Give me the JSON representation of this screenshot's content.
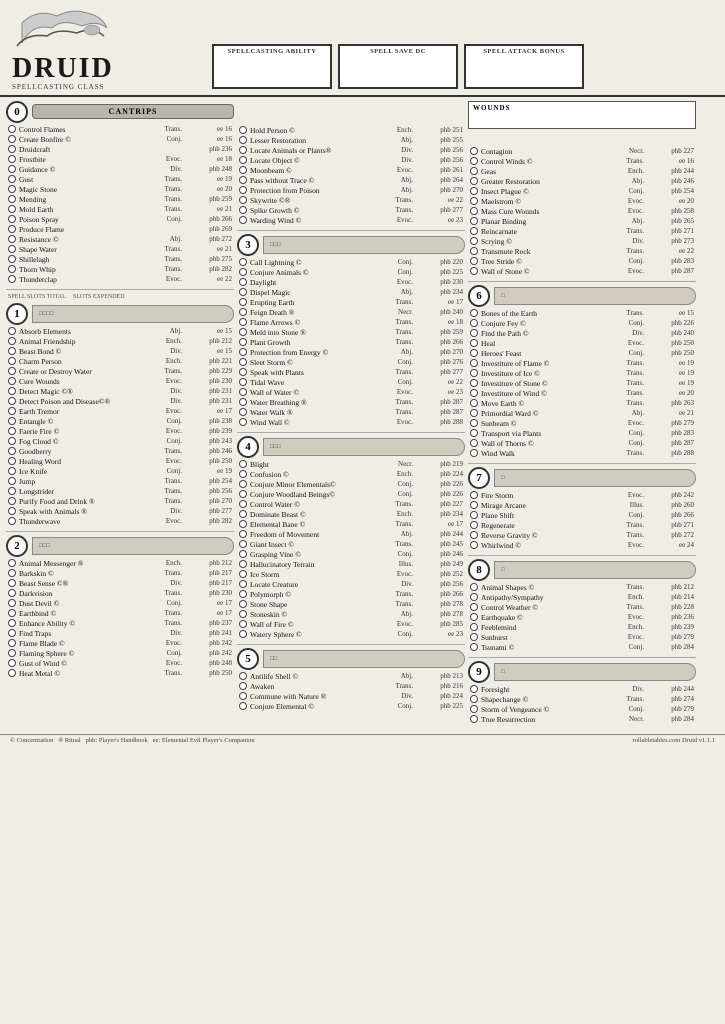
{
  "header": {
    "title": "Druid",
    "spellcasting_class": "Spellcasting Class",
    "spellcasting_ability": "Spellcasting Ability",
    "spell_save_dc": "Spell Save DC",
    "spell_attack_bonus": "Spell Attack Bonus"
  },
  "footer": {
    "concentration": "© Concentration",
    "ritual": "® Ritual",
    "phb": "phb: Player's Handbook",
    "ee": "ee: Elemental Evil Player's Companion",
    "url": "rollabletables.com Druid v1.1.1"
  },
  "cantrips": {
    "label": "Cantrips",
    "spells": [
      {
        "name": "Control Flames",
        "school": "Trans.",
        "source": "ee 16"
      },
      {
        "name": "Create Bonfire ©",
        "school": "Conj.",
        "source": "ee 16"
      },
      {
        "name": "Druidcraft",
        "school": "",
        "source": "phb 236"
      },
      {
        "name": "Frostbite",
        "school": "Evoc.",
        "source": "ee 18"
      },
      {
        "name": "Guidance ©",
        "school": "Div.",
        "source": "phb 248"
      },
      {
        "name": "Gust",
        "school": "Trans.",
        "source": "ee 19"
      },
      {
        "name": "Magic Stone",
        "school": "Trans.",
        "source": "ee 20"
      },
      {
        "name": "Mending",
        "school": "Trans.",
        "source": "phb 259"
      },
      {
        "name": "Mold Earth",
        "school": "Trans.",
        "source": "ee 21"
      },
      {
        "name": "Poison Spray",
        "school": "Conj.",
        "source": "phb 266"
      },
      {
        "name": "Produce Flame",
        "school": "",
        "source": "phb 269"
      },
      {
        "name": "Resistance ©",
        "school": "Abj.",
        "source": "phb 272"
      },
      {
        "name": "Shape Water",
        "school": "Trans.",
        "source": "ee 21"
      },
      {
        "name": "Shillelagh",
        "school": "Trans.",
        "source": "phb 275"
      },
      {
        "name": "Thorn Whip",
        "school": "Trans.",
        "source": "phb 282"
      },
      {
        "name": "Thunderclap",
        "school": "Evoc.",
        "source": "ee 22"
      }
    ]
  },
  "level1": {
    "spells": [
      {
        "name": "Absorb Elements",
        "school": "Abj.",
        "source": "ee 15"
      },
      {
        "name": "Animal Friendship",
        "school": "Ench.",
        "source": "phb 212"
      },
      {
        "name": "Beast Bond ©",
        "school": "Div.",
        "source": "ee 15"
      },
      {
        "name": "Charm Person",
        "school": "Ench.",
        "source": "phb 221"
      },
      {
        "name": "Create or Destroy Water",
        "school": "Trans.",
        "source": "phb 229"
      },
      {
        "name": "Cure Wounds",
        "school": "Evoc.",
        "source": "phb 230"
      },
      {
        "name": "Detect Magic ©®",
        "school": "Div.",
        "source": "phb 231"
      },
      {
        "name": "Detect Poison and Disease©®",
        "school": "Div.",
        "source": "phb 231"
      },
      {
        "name": "Earth Tremor",
        "school": "Evoc.",
        "source": "ee 17"
      },
      {
        "name": "Entangle ©",
        "school": "Conj.",
        "source": "phb 238"
      },
      {
        "name": "Faerie Fire ©",
        "school": "Evoc.",
        "source": "phb 239"
      },
      {
        "name": "Fog Cloud ©",
        "school": "Conj.",
        "source": "phb 243"
      },
      {
        "name": "Goodberry",
        "school": "Trans.",
        "source": "phb 246"
      },
      {
        "name": "Healing Word",
        "school": "Evoc.",
        "source": "phb 250"
      },
      {
        "name": "Ice Knife",
        "school": "Conj.",
        "source": "ee 19"
      },
      {
        "name": "Jump",
        "school": "Trans.",
        "source": "phb 254"
      },
      {
        "name": "Longstrider",
        "school": "Trans.",
        "source": "phb 256"
      },
      {
        "name": "Purify Food and Drink ®",
        "school": "Trans.",
        "source": "phb 270"
      },
      {
        "name": "Speak with Animals ®",
        "school": "Div.",
        "source": "phb 277"
      },
      {
        "name": "Thunderwave",
        "school": "Evoc.",
        "source": "phb 282"
      }
    ]
  },
  "level2": {
    "spells": [
      {
        "name": "Animal Messenger ®",
        "school": "Ench.",
        "source": "phb 212"
      },
      {
        "name": "Barkskin ©",
        "school": "Trans.",
        "source": "phb 217"
      },
      {
        "name": "Beast Sense ©®",
        "school": "Div.",
        "source": "phb 217"
      },
      {
        "name": "Darkvision",
        "school": "Trans.",
        "source": "phb 230"
      },
      {
        "name": "Dust Devil ©",
        "school": "Conj.",
        "source": "ee 17"
      },
      {
        "name": "Earthbind ©",
        "school": "Trans.",
        "source": "ee 17"
      },
      {
        "name": "Enhance Ability ©",
        "school": "Trans.",
        "source": "phb 237"
      },
      {
        "name": "Find Traps",
        "school": "Div.",
        "source": "phb 241"
      },
      {
        "name": "Flame Blade ©",
        "school": "Evoc.",
        "source": "phb 242"
      },
      {
        "name": "Flaming Sphere ©",
        "school": "Conj.",
        "source": "phb 242"
      },
      {
        "name": "Gust of Wind ©",
        "school": "Evoc.",
        "source": "phb 248"
      },
      {
        "name": "Heat Metal ©",
        "school": "Trans.",
        "source": "phb 250"
      }
    ]
  },
  "level2b": {
    "spells": [
      {
        "name": "Hold Person ©",
        "school": "Ench.",
        "source": "phb 251"
      },
      {
        "name": "Lesser Restoration",
        "school": "Abj.",
        "source": "phb 255"
      },
      {
        "name": "Locate Animals or Plants®",
        "school": "Div.",
        "source": "phb 256"
      },
      {
        "name": "Locate Object ©",
        "school": "Div.",
        "source": "phb 256"
      },
      {
        "name": "Moonbeam ©",
        "school": "Evoc.",
        "source": "phb 261"
      },
      {
        "name": "Pass without Trace ©",
        "school": "Abj.",
        "source": "phb 264"
      },
      {
        "name": "Protection from Poison",
        "school": "Abj.",
        "source": "phb 270"
      },
      {
        "name": "Skywrite ©®",
        "school": "Trans.",
        "source": "ee 22"
      },
      {
        "name": "Spike Growth ©",
        "school": "Trans.",
        "source": "phb 277"
      },
      {
        "name": "Warding Wind ©",
        "school": "Evoc.",
        "source": "ee 23"
      }
    ]
  },
  "level3": {
    "spells": [
      {
        "name": "Call Lightning ©",
        "school": "Conj.",
        "source": "phb 220"
      },
      {
        "name": "Conjure Animals ©",
        "school": "Conj.",
        "source": "phb 225"
      },
      {
        "name": "Daylight",
        "school": "Evoc.",
        "source": "phb 230"
      },
      {
        "name": "Dispel Magic",
        "school": "Abj.",
        "source": "phb 234"
      },
      {
        "name": "Erupting Earth",
        "school": "Trans.",
        "source": "ee 17"
      },
      {
        "name": "Feign Death ®",
        "school": "Necr.",
        "source": "phb 240"
      },
      {
        "name": "Flame Arrows ©",
        "school": "Trans.",
        "source": "ee 18"
      },
      {
        "name": "Meld into Stone ®",
        "school": "Trans.",
        "source": "phb 259"
      },
      {
        "name": "Plant Growth",
        "school": "Trans.",
        "source": "phb 266"
      },
      {
        "name": "Protection from Energy ©",
        "school": "Abj.",
        "source": "phb 270"
      },
      {
        "name": "Sleet Storm ©",
        "school": "Conj.",
        "source": "phb 276"
      },
      {
        "name": "Speak with Plants",
        "school": "Trans.",
        "source": "phb 277"
      },
      {
        "name": "Tidal Wave",
        "school": "Conj.",
        "source": "ee 22"
      },
      {
        "name": "Wall of Water ©",
        "school": "Evoc.",
        "source": "ee 23"
      },
      {
        "name": "Water Breathing ®",
        "school": "Trans.",
        "source": "phb 287"
      },
      {
        "name": "Water Walk ®",
        "school": "Trans.",
        "source": "phb 287"
      },
      {
        "name": "Wind Wall ©",
        "school": "Evoc.",
        "source": "phb 288"
      }
    ]
  },
  "level4": {
    "spells": [
      {
        "name": "Blight",
        "school": "Necr.",
        "source": "phb 219"
      },
      {
        "name": "Confusion ©",
        "school": "Ench.",
        "source": "phb 224"
      },
      {
        "name": "Conjure Minor Elementals©",
        "school": "Conj.",
        "source": "phb 226"
      },
      {
        "name": "Conjure Woodland Beings©",
        "school": "Conj.",
        "source": "phb 226"
      },
      {
        "name": "Control Water ©",
        "school": "Trans.",
        "source": "phb 227"
      },
      {
        "name": "Dominate Beast ©",
        "school": "Ench.",
        "source": "phb 234"
      },
      {
        "name": "Elemental Bane ©",
        "school": "Trans.",
        "source": "ee 17"
      },
      {
        "name": "Freedom of Movement",
        "school": "Abj.",
        "source": "phb 244"
      },
      {
        "name": "Giant Insect ©",
        "school": "Trans.",
        "source": "phb 245"
      },
      {
        "name": "Grasping Vine ©",
        "school": "Conj.",
        "source": "phb 246"
      },
      {
        "name": "Hallucinatory Terrain",
        "school": "Illus.",
        "source": "phb 249"
      },
      {
        "name": "Ice Storm",
        "school": "Evoc.",
        "source": "phb 252"
      },
      {
        "name": "Locate Creature",
        "school": "Div.",
        "source": "phb 256"
      },
      {
        "name": "Polymorph ©",
        "school": "Trans.",
        "source": "phb 266"
      },
      {
        "name": "Stone Shape",
        "school": "Trans.",
        "source": "phb 278"
      },
      {
        "name": "Stoneskin ©",
        "school": "Abj.",
        "source": "phb 278"
      },
      {
        "name": "Wall of Fire ©",
        "school": "Evoc.",
        "source": "phb 285"
      },
      {
        "name": "Watery Sphere ©",
        "school": "Conj.",
        "source": "ee 23"
      }
    ]
  },
  "level5": {
    "spells": [
      {
        "name": "Antilife Shell ©",
        "school": "Abj.",
        "source": "phb 213"
      },
      {
        "name": "Awaken",
        "school": "Trans.",
        "source": "phb 216"
      },
      {
        "name": "Commune with Nature ®",
        "school": "Div.",
        "source": "phb 224"
      },
      {
        "name": "Conjure Elemental ©",
        "school": "Conj.",
        "source": "phb 225"
      }
    ]
  },
  "level5b": {
    "spells": [
      {
        "name": "Contagion",
        "school": "Necr.",
        "source": "phb 227"
      },
      {
        "name": "Control Winds ©",
        "school": "Trans.",
        "source": "ee 16"
      },
      {
        "name": "Geas",
        "school": "Ench.",
        "source": "phb 244"
      },
      {
        "name": "Greater Restoration",
        "school": "Abj.",
        "source": "phb 246"
      },
      {
        "name": "Insect Plague ©",
        "school": "Conj.",
        "source": "phb 254"
      },
      {
        "name": "Maelstrom ©",
        "school": "Evoc.",
        "source": "ee 20"
      },
      {
        "name": "Mass Cure Wounds",
        "school": "Evoc.",
        "source": "phb 258"
      },
      {
        "name": "Planar Binding",
        "school": "Abj.",
        "source": "phb 265"
      },
      {
        "name": "Reincarnate",
        "school": "Trans.",
        "source": "phb 271"
      },
      {
        "name": "Scrying ©",
        "school": "Div.",
        "source": "phb 273"
      },
      {
        "name": "Transmute Rock",
        "school": "Trans.",
        "source": "ee 22"
      },
      {
        "name": "Tree Stride ©",
        "school": "Conj.",
        "source": "phb 283"
      },
      {
        "name": "Wall of Stone ©",
        "school": "Evoc.",
        "source": "phb 287"
      }
    ]
  },
  "level6": {
    "spells": [
      {
        "name": "Bones of the Earth",
        "school": "Trans.",
        "source": "ee 15"
      },
      {
        "name": "Conjure Fey ©",
        "school": "Conj.",
        "source": "phb 226"
      },
      {
        "name": "Find the Path ©",
        "school": "Div.",
        "source": "phb 240"
      },
      {
        "name": "Heal",
        "school": "Evoc.",
        "source": "phb 250"
      },
      {
        "name": "Heroes' Feast",
        "school": "Conj.",
        "source": "phb 250"
      },
      {
        "name": "Investiture of Flame ©",
        "school": "Trans.",
        "source": "ee 19"
      },
      {
        "name": "Investiture of Ice ©",
        "school": "Trans.",
        "source": "ee 19"
      },
      {
        "name": "Investiture of Stone ©",
        "school": "Trans.",
        "source": "ee 19"
      },
      {
        "name": "Investiture of Wind ©",
        "school": "Trans.",
        "source": "ee 20"
      },
      {
        "name": "Move Earth ©",
        "school": "Trans.",
        "source": "phb 263"
      },
      {
        "name": "Primordial Ward ©",
        "school": "Abj.",
        "source": "ee 21"
      },
      {
        "name": "Sunbeam ©",
        "school": "Evoc.",
        "source": "phb 279"
      },
      {
        "name": "Transport via Plants",
        "school": "Conj.",
        "source": "phb 283"
      },
      {
        "name": "Wall of Thorns ©",
        "school": "Conj.",
        "source": "phb 287"
      },
      {
        "name": "Wind Walk",
        "school": "Trans.",
        "source": "phb 288"
      }
    ]
  },
  "level7": {
    "spells": [
      {
        "name": "Fire Storm",
        "school": "Evoc.",
        "source": "phb 242"
      },
      {
        "name": "Mirage Arcane",
        "school": "Illus.",
        "source": "phb 260"
      },
      {
        "name": "Plane Shift",
        "school": "Conj.",
        "source": "phb 266"
      },
      {
        "name": "Regenerate",
        "school": "Trans.",
        "source": "phb 271"
      },
      {
        "name": "Reverse Gravity ©",
        "school": "Trans.",
        "source": "phb 272"
      },
      {
        "name": "Whirlwind ©",
        "school": "Evoc.",
        "source": "ee 24"
      }
    ]
  },
  "level8": {
    "spells": [
      {
        "name": "Animal Shapes ©",
        "school": "Trans.",
        "source": "phb 212"
      },
      {
        "name": "Antipathy/Sympathy",
        "school": "Ench.",
        "source": "phb 214"
      },
      {
        "name": "Control Weather ©",
        "school": "Trans.",
        "source": "phb 228"
      },
      {
        "name": "Earthquake ©",
        "school": "Evoc.",
        "source": "phb 236"
      },
      {
        "name": "Feeblemind",
        "school": "Ench.",
        "source": "phb 239"
      },
      {
        "name": "Sunburst",
        "school": "Evoc.",
        "source": "phb 279"
      },
      {
        "name": "Tsunami ©",
        "school": "Conj.",
        "source": "phb 284"
      }
    ]
  },
  "level9": {
    "spells": [
      {
        "name": "Foresight",
        "school": "Div.",
        "source": "phb 244"
      },
      {
        "name": "Shapechange ©",
        "school": "Trans.",
        "source": "phb 274"
      },
      {
        "name": "Storm of Vengeance ©",
        "school": "Conj.",
        "source": "phb 279"
      },
      {
        "name": "True Resurrection",
        "school": "Necr.",
        "source": "phb 284"
      }
    ]
  },
  "wounds": {
    "label": "Wounds"
  }
}
